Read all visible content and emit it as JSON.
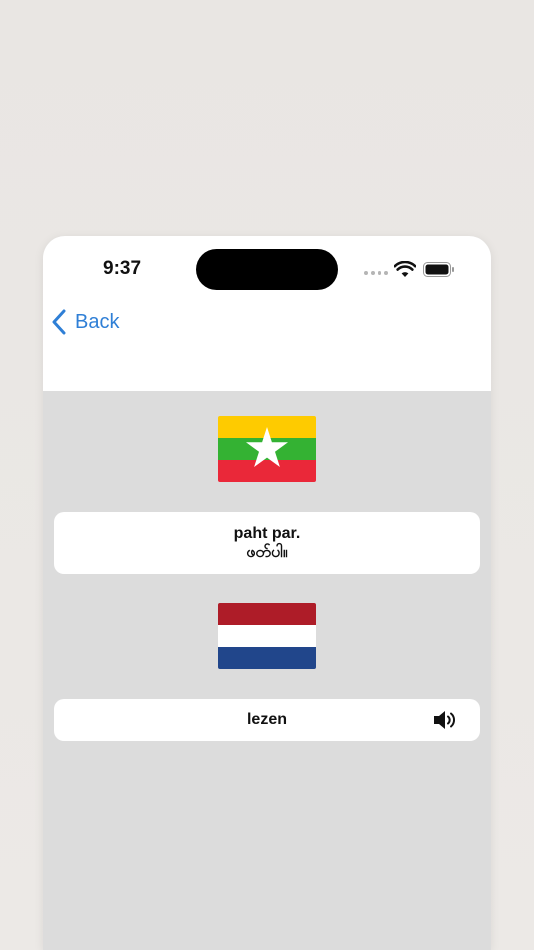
{
  "status_bar": {
    "time": "9:37",
    "icons": [
      "cellular-dots-icon",
      "wifi-icon",
      "battery-icon"
    ]
  },
  "nav": {
    "back_label": "Back",
    "back_icon": "chevron-left-icon"
  },
  "source": {
    "flag": "myanmar-flag-icon",
    "romanization": "paht par.",
    "script": "ဖတ်ပါ။"
  },
  "target": {
    "flag": "netherlands-flag-icon",
    "word": "lezen",
    "audio_icon": "speaker-icon"
  },
  "colors": {
    "accent": "#2f7fd6",
    "content_background": "#dcdcdc",
    "card_background": "#ffffff",
    "myanmar_yellow": "#fecb00",
    "myanmar_green": "#34b233",
    "myanmar_red": "#ea2839",
    "nl_red": "#ae1c28",
    "nl_white": "#ffffff",
    "nl_blue": "#21468b"
  }
}
